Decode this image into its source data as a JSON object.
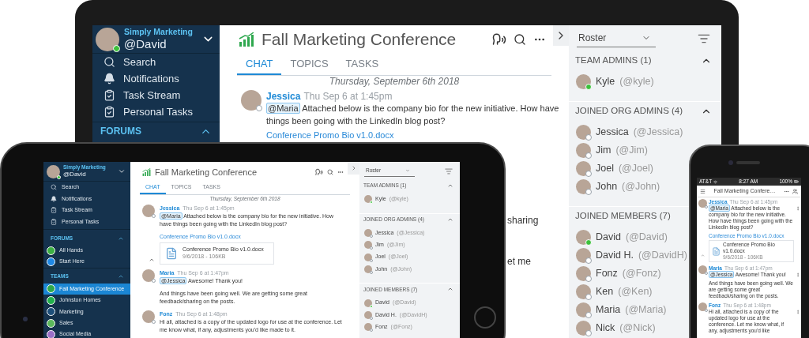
{
  "laptop": {
    "sidebar": {
      "org": "Simply Marketing",
      "user": "@David",
      "online": true,
      "nav": [
        {
          "kind": "search",
          "label": "Search"
        },
        {
          "kind": "bell",
          "label": "Notifications"
        },
        {
          "kind": "task",
          "label": "Task Stream"
        },
        {
          "kind": "task",
          "label": "Personal Tasks"
        }
      ],
      "sections": [
        {
          "title": "FORUMS"
        }
      ]
    },
    "chat": {
      "title": "Fall Marketing Conference",
      "tabs": [
        {
          "label": "CHAT",
          "selected": true
        },
        {
          "label": "TOPICS",
          "selected": false
        },
        {
          "label": "TASKS",
          "selected": false
        }
      ],
      "date": "Thursday, September 6th 2018",
      "messages": [
        {
          "author": "Jessica",
          "time": "Thu Sep 6 at 1:45pm",
          "online": false,
          "mention": "@Maria",
          "text": "Attached below is the company bio for the new initiative. How have things been going with the LinkedIn blog post?",
          "link": "Conference Promo Bio v1.0.docx"
        }
      ],
      "fragments": [
        "sharing",
        "et me"
      ]
    },
    "roster": {
      "dropdown": "Roster",
      "sections": [
        {
          "title": "TEAM ADMINS (1)",
          "members": [
            {
              "name": "Kyle",
              "handle": "(@kyle)",
              "online": true
            }
          ]
        },
        {
          "title": "JOINED ORG ADMINS (4)",
          "members": [
            {
              "name": "Jessica",
              "handle": "(@Jessica)",
              "online": false
            },
            {
              "name": "Jim",
              "handle": "(@Jim)",
              "online": false
            },
            {
              "name": "Joel",
              "handle": "(@Joel)",
              "online": false
            },
            {
              "name": "John",
              "handle": "(@John)",
              "online": false
            }
          ]
        },
        {
          "title": "JOINED MEMBERS (7)",
          "members": [
            {
              "name": "David",
              "handle": "(@David)",
              "online": true
            },
            {
              "name": "David H.",
              "handle": "(@DavidH)",
              "online": false
            },
            {
              "name": "Fonz",
              "handle": "(@Fonz)",
              "online": false
            },
            {
              "name": "Ken",
              "handle": "(@Ken)",
              "online": false
            },
            {
              "name": "Maria",
              "handle": "(@Maria)",
              "online": false
            },
            {
              "name": "Nick",
              "handle": "(@Nick)",
              "online": false
            }
          ]
        }
      ]
    }
  },
  "tablet": {
    "sidebar": {
      "org": "Simply Marketing",
      "user": "@David",
      "online": true,
      "nav": [
        {
          "kind": "search",
          "label": "Search"
        },
        {
          "kind": "bell",
          "label": "Notifications"
        },
        {
          "kind": "task",
          "label": "Task Stream"
        },
        {
          "kind": "task",
          "label": "Personal Tasks"
        }
      ],
      "sections": [
        {
          "title": "FORUMS",
          "items": [
            {
              "label": "All Hands",
              "color": "#3cb043",
              "selected": false
            },
            {
              "label": "Start Here",
              "color": "#1e88e5",
              "selected": false
            }
          ]
        },
        {
          "title": "TEAMS",
          "items": [
            {
              "label": "Fall Marketing Conference",
              "color": "#2ea84a",
              "selected": true
            },
            {
              "label": "Johnston Homes",
              "color": "#22b14c",
              "selected": false
            },
            {
              "label": "Marketing",
              "color": "#1d4f7a",
              "selected": false
            },
            {
              "label": "Sales",
              "color": "#5cb85c",
              "selected": false
            },
            {
              "label": "Social Media",
              "color": "#9b6fc7",
              "selected": false
            }
          ]
        }
      ]
    },
    "chat": {
      "title": "Fall Marketing Conference",
      "tabs": [
        {
          "label": "CHAT",
          "selected": true
        },
        {
          "label": "TOPICS",
          "selected": false
        },
        {
          "label": "TASKS",
          "selected": false
        }
      ],
      "date": "Thursday, September 6th 2018",
      "messages": [
        {
          "author": "Jessica",
          "time": "Thu Sep 6 at 1:45pm",
          "online": false,
          "mention": "@Maria",
          "text": "Attached below is the company bio for the new initiative. How have things been going with the LinkedIn blog post?",
          "link": "Conference Promo Bio v1.0.docx",
          "file": "Conference Promo Bio v1.0.docx",
          "meta": "9/6/2018 - 106KB"
        },
        {
          "author": "Maria",
          "time": "Thu Sep 6 at 1:47pm",
          "online": false,
          "mention": "@Jessica",
          "text": "Awesome! Thank you!",
          "more": "And things have been going well. We are getting some great feedback/sharing on the posts."
        },
        {
          "author": "Fonz",
          "time": "Thu Sep 6 at 1:48pm",
          "online": false,
          "text": "Hi all, attached is a copy of the updated logo for use at the conference. Let me know what, if any, adjustments you'd like made to it."
        }
      ]
    },
    "roster": {
      "dropdown": "Roster",
      "sections": [
        {
          "title": "TEAM ADMINS (1)",
          "members": [
            {
              "name": "Kyle",
              "handle": "(@kyle)",
              "online": true
            }
          ]
        },
        {
          "title": "JOINED ORG ADMINS (4)",
          "members": [
            {
              "name": "Jessica",
              "handle": "(@Jessica)",
              "online": false
            },
            {
              "name": "Jim",
              "handle": "(@Jim)",
              "online": false
            },
            {
              "name": "Joel",
              "handle": "(@Joel)",
              "online": false
            },
            {
              "name": "John",
              "handle": "(@John)",
              "online": false
            }
          ]
        },
        {
          "title": "JOINED MEMBERS (7)",
          "members": [
            {
              "name": "David",
              "handle": "(@David)",
              "online": true
            },
            {
              "name": "David H.",
              "handle": "(@DavidH)",
              "online": false
            },
            {
              "name": "Fonz",
              "handle": "(@Fonz)",
              "online": false
            }
          ]
        }
      ]
    }
  },
  "phone": {
    "carrier": "AT&T",
    "clock": "8:27 AM",
    "battery": "100%",
    "title": "Fall Marketing Confere…",
    "messages": [
      {
        "author": "Jessica",
        "time": "Thu Sep 6 at 1:45pm",
        "online": false,
        "mention": "@Maria",
        "text": "Attached below is the company bio for the new initiative. How have things been going with the LinkedIn blog post?",
        "link": "Conference Promo Bio v1.0.docx",
        "file": "Conference Promo Bio v1.0.docx",
        "meta": "9/6/2018 - 106KB"
      },
      {
        "author": "Maria",
        "time": "Thu Sep 6 at 1:47pm",
        "online": false,
        "mention": "@Jessica",
        "text": "Awesome! Thank you!",
        "more": "And things have been going well. We are getting some great feedback/sharing on the posts."
      },
      {
        "author": "Fonz",
        "time": "Thu Sep 6 at 1:48pm",
        "online": false,
        "text": "Hi all, attached is a copy of the updated logo for use at the conference. Let me know what, if any, adjustments you'd like"
      }
    ]
  }
}
